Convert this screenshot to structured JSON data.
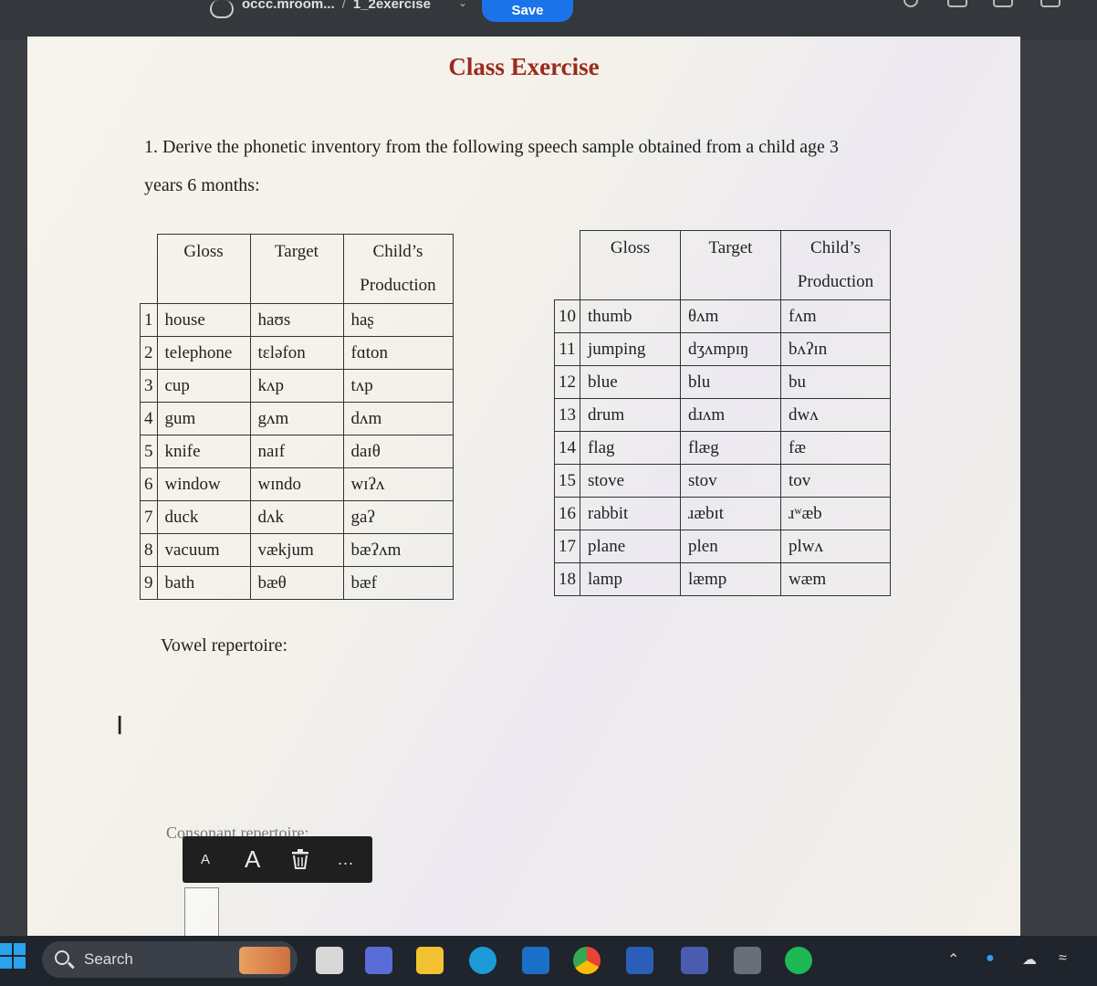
{
  "topbar": {
    "breadcrumb_site": "occc.mroom...",
    "breadcrumb_sep": "/",
    "breadcrumb_file": "1_2exercise",
    "save_label": "Save"
  },
  "document": {
    "title": "Class Exercise",
    "question_line1": "1. Derive the phonetic inventory from the following speech sample obtained from a child age 3",
    "question_line2": "years 6 months:",
    "headers": {
      "gloss": "Gloss",
      "target": "Target",
      "child1": "Child’s",
      "child2": "Production"
    },
    "table_left": [
      {
        "n": "1",
        "gloss": "house",
        "target": "haʊs",
        "child": "haʂ"
      },
      {
        "n": "2",
        "gloss": "telephone",
        "target": "tɛləfon",
        "child": "fɑton"
      },
      {
        "n": "3",
        "gloss": "cup",
        "target": "kʌp",
        "child": "tʌp"
      },
      {
        "n": "4",
        "gloss": "gum",
        "target": "gʌm",
        "child": "dʌm"
      },
      {
        "n": "5",
        "gloss": "knife",
        "target": "naɪf",
        "child": "daɪθ"
      },
      {
        "n": "6",
        "gloss": "window",
        "target": "wɪndo",
        "child": "wɪʔʌ"
      },
      {
        "n": "7",
        "gloss": "duck",
        "target": "dʌk",
        "child": "gaʔ"
      },
      {
        "n": "8",
        "gloss": "vacuum",
        "target": "vækjum",
        "child": "bæʔʌm"
      },
      {
        "n": "9",
        "gloss": "bath",
        "target": "bæθ",
        "child": "bæf"
      }
    ],
    "table_right": [
      {
        "n": "10",
        "gloss": "thumb",
        "target": "θʌm",
        "child": "fʌm"
      },
      {
        "n": "11",
        "gloss": "jumping",
        "target": "dʒʌmpɪŋ",
        "child": "bʌʔɪn"
      },
      {
        "n": "12",
        "gloss": "blue",
        "target": "blu",
        "child": "bu"
      },
      {
        "n": "13",
        "gloss": "drum",
        "target": "dɹʌm",
        "child": "dwʌ"
      },
      {
        "n": "14",
        "gloss": "flag",
        "target": "flæg",
        "child": "fæ"
      },
      {
        "n": "15",
        "gloss": "stove",
        "target": "stov",
        "child": "tov"
      },
      {
        "n": "16",
        "gloss": "rabbit",
        "target": "ɹæbɪt",
        "child": "ɹʷæb"
      },
      {
        "n": "17",
        "gloss": "plane",
        "target": "plen",
        "child": "plwʌ"
      },
      {
        "n": "18",
        "gloss": "lamp",
        "target": "læmp",
        "child": "wæm"
      }
    ],
    "vowel_label": "Vowel repertoire:",
    "consonant_label": "Consonant repertoire:"
  },
  "float_toolbar": {
    "small_a": "A",
    "big_a": "A",
    "more": "..."
  },
  "taskbar": {
    "search_label": "Search"
  },
  "colors": {
    "title": "#9b2a1e",
    "save_button": "#1a73e8",
    "taskbar": "#20242c"
  }
}
